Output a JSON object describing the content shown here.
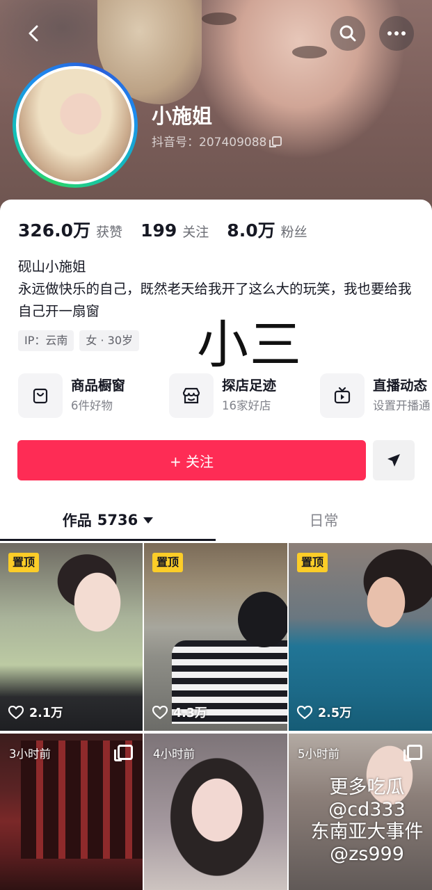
{
  "profile": {
    "name": "小施姐",
    "douyin_id": "抖音号：207409088"
  },
  "stats": [
    {
      "value": "326.0万",
      "label": "获赞"
    },
    {
      "value": "199",
      "label": "关注"
    },
    {
      "value": "8.0万",
      "label": "粉丝"
    }
  ],
  "bio": {
    "line1": "砚山小施姐",
    "line2": "永远做快乐的自己，既然老天给我开了这么大的玩笑，我也要给我自己开一扇窗"
  },
  "tags": [
    "IP：云南",
    "女 · 30岁"
  ],
  "overlay_text": "小三",
  "features": [
    {
      "title": "商品橱窗",
      "subtitle": "6件好物",
      "icon": "bag-icon"
    },
    {
      "title": "探店足迹",
      "subtitle": "16家好店",
      "icon": "store-icon"
    },
    {
      "title": "直播动态",
      "subtitle": "设置开播通",
      "icon": "tv-icon"
    }
  ],
  "actions": {
    "follow_label": "+ 关注",
    "share_icon": "send-icon"
  },
  "tabs": {
    "works_label": "作品",
    "works_count": "5736",
    "daily_label": "日常"
  },
  "videos": [
    {
      "badge": "置顶",
      "likes": "2.1万"
    },
    {
      "badge": "置顶",
      "likes": "4.3万"
    },
    {
      "badge": "置顶",
      "likes": "2.5万"
    },
    {
      "time": "3小时前"
    },
    {
      "time": "4小时前"
    },
    {
      "time": "5小时前"
    }
  ],
  "watermark": {
    "line1": "更多吃瓜",
    "line2": "@cd333",
    "line3": "东南亚大事件",
    "line4": "@zs999"
  },
  "colors": {
    "accent": "#fe2c55",
    "pin_badge": "#fccd28"
  }
}
